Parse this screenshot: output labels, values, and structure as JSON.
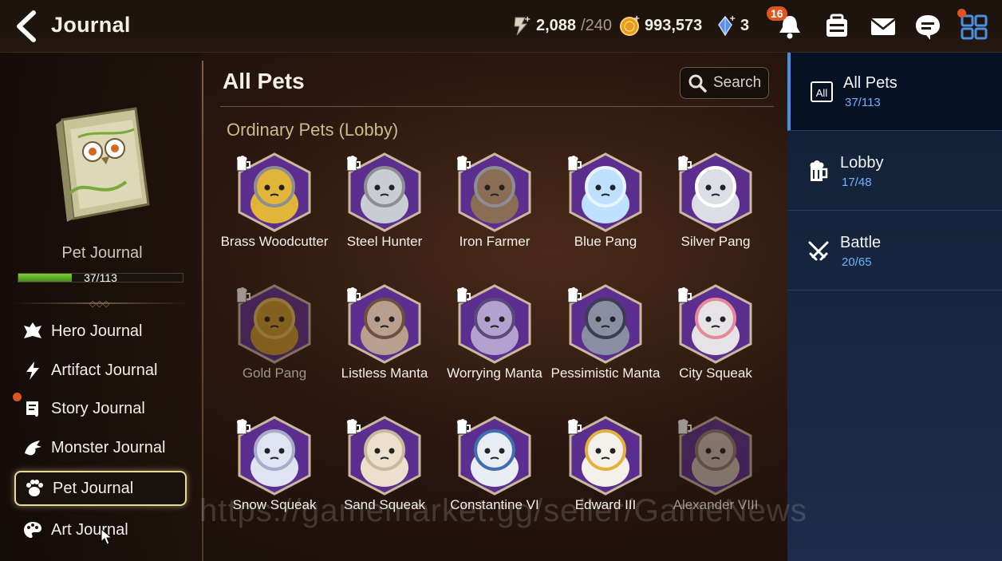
{
  "header": {
    "title": "Journal",
    "stamina": "2,088",
    "stamina_max": "/240",
    "gold": "993,573",
    "crystals": "3",
    "notification_count": "16"
  },
  "sidebar": {
    "journal_name": "Pet Journal",
    "progress_text": "37/113",
    "progress_fraction": 0.327,
    "items": [
      {
        "label": "Hero Journal",
        "icon": "hero-icon"
      },
      {
        "label": "Artifact Journal",
        "icon": "lightning-icon"
      },
      {
        "label": "Story Journal",
        "icon": "scroll-icon"
      },
      {
        "label": "Monster Journal",
        "icon": "dragon-icon"
      },
      {
        "label": "Pet Journal",
        "icon": "paw-icon",
        "active": true
      },
      {
        "label": "Art Journal",
        "icon": "palette-icon"
      }
    ]
  },
  "main": {
    "title": "All Pets",
    "search_label": "Search",
    "section_title": "Ordinary Pets (Lobby)",
    "pets": [
      {
        "name": "Brass Woodcutter",
        "owned": true
      },
      {
        "name": "Steel Hunter",
        "owned": true
      },
      {
        "name": "Iron Farmer",
        "owned": true
      },
      {
        "name": "Blue Pang",
        "owned": true
      },
      {
        "name": "Silver Pang",
        "owned": true
      },
      {
        "name": "Gold Pang",
        "owned": false
      },
      {
        "name": "Listless Manta",
        "owned": true
      },
      {
        "name": "Worrying Manta",
        "owned": true
      },
      {
        "name": "Pessimistic Manta",
        "owned": true
      },
      {
        "name": "City Squeak",
        "owned": true
      },
      {
        "name": "Snow Squeak",
        "owned": true
      },
      {
        "name": "Sand Squeak",
        "owned": true
      },
      {
        "name": "Constantine VI",
        "owned": true
      },
      {
        "name": "Edward III",
        "owned": true
      },
      {
        "name": "Alexander VIII",
        "owned": false
      }
    ]
  },
  "tabs": [
    {
      "label": "All Pets",
      "count": "37/113",
      "icon": "all-icon",
      "icon_text": "All",
      "active": true
    },
    {
      "label": "Lobby",
      "count": "17/48",
      "icon": "beer-mug-icon"
    },
    {
      "label": "Battle",
      "count": "20/65",
      "icon": "crossed-swords-icon"
    }
  ],
  "watermark": "https://gamemarket.gg/seller/GameNews",
  "colors": {
    "accent_blue": "#4c8ee0",
    "count_blue": "#6fb2ff",
    "gold_text": "#cfb98a",
    "badge_orange": "#e0541f",
    "progress_green": "#5fae2a"
  }
}
